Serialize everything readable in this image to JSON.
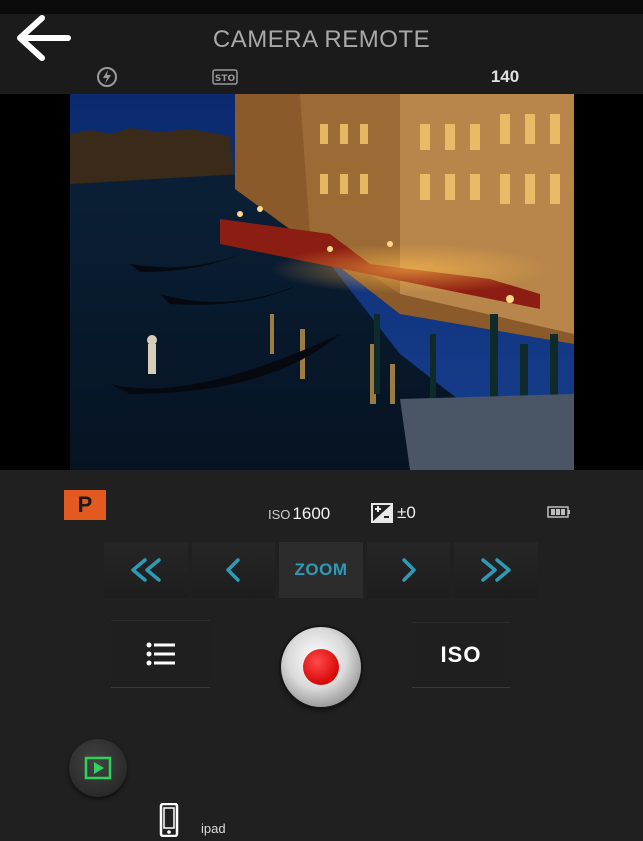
{
  "header": {
    "title": "CAMERA REMOTE"
  },
  "status_bar": {
    "flash_icon": "flash-off-icon",
    "stabilizer_icon": "sto-icon",
    "shots_remaining": "140"
  },
  "viewfinder": {
    "scene": "night canal with gondolas and lit buildings"
  },
  "info": {
    "mode": "P",
    "iso_prefix": "ISO",
    "iso_value": "1600",
    "ev_value": "±0",
    "battery_icon": "battery-icon"
  },
  "zoom_controls": {
    "label": "ZOOM"
  },
  "controls": {
    "iso_label": "ISO"
  },
  "footer": {
    "device_name": "ipad"
  },
  "colors": {
    "accent": "#2d9bb8",
    "mode_badge": "#e25a1f",
    "shutter_red": "#d80808",
    "play_green": "#2bd45a"
  }
}
